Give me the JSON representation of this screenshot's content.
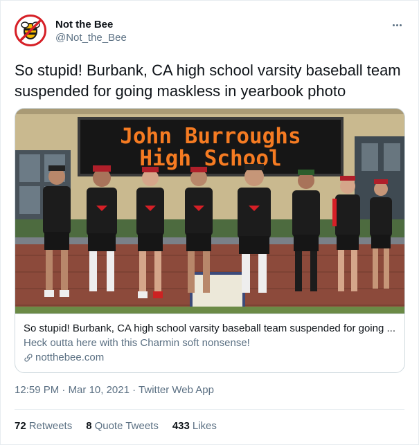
{
  "account": {
    "display_name": "Not the Bee",
    "handle": "@Not_the_Bee",
    "avatar_icon": "not-the-bee-logo"
  },
  "more_icon": "more-horizontal-icon",
  "tweet": {
    "text": "So stupid! Burbank, CA high school varsity baseball team suspended for going maskless in yearbook photo"
  },
  "card": {
    "sign_line1": "John Burroughs",
    "sign_line2": "High School",
    "title": "So stupid! Burbank, CA high school varsity baseball team suspended for going ...",
    "description": "Heck outta here with this Charmin soft nonsense!",
    "domain": "notthebee.com",
    "link_icon": "link-icon"
  },
  "meta": {
    "time": "12:59 PM",
    "separator": "·",
    "date": "Mar 10, 2021",
    "app": "Twitter Web App"
  },
  "stats": {
    "retweets_count": "72",
    "retweets_label": "Retweets",
    "quotes_count": "8",
    "quotes_label": "Quote Tweets",
    "likes_count": "433",
    "likes_label": "Likes"
  },
  "colors": {
    "brand_red": "#d61f26",
    "bee_yellow": "#f5b800",
    "led_orange": "#f57b22",
    "secondary_text": "#5b7083"
  }
}
